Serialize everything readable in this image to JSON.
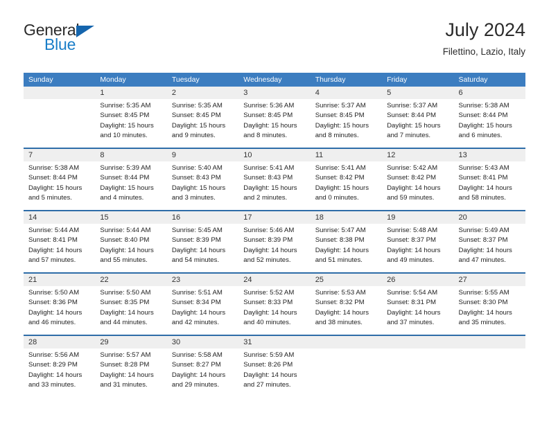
{
  "brand": {
    "name_top": "General",
    "name_bottom": "Blue",
    "accent_color": "#1a7ec8",
    "triangle_color": "#1565ad"
  },
  "header": {
    "title": "July 2024",
    "subtitle": "Filettino, Lazio, Italy"
  },
  "theme": {
    "header_row_bg": "#3c7dc0",
    "week_divider": "#2e6da8",
    "daynum_band_bg": "#efefef",
    "text_color": "#222222"
  },
  "calendar": {
    "weekdays": [
      "Sunday",
      "Monday",
      "Tuesday",
      "Wednesday",
      "Thursday",
      "Friday",
      "Saturday"
    ],
    "weeks": [
      [
        {
          "day": "",
          "detail": ""
        },
        {
          "day": "1",
          "detail": "Sunrise: 5:35 AM\nSunset: 8:45 PM\nDaylight: 15 hours\nand 10 minutes."
        },
        {
          "day": "2",
          "detail": "Sunrise: 5:35 AM\nSunset: 8:45 PM\nDaylight: 15 hours\nand 9 minutes."
        },
        {
          "day": "3",
          "detail": "Sunrise: 5:36 AM\nSunset: 8:45 PM\nDaylight: 15 hours\nand 8 minutes."
        },
        {
          "day": "4",
          "detail": "Sunrise: 5:37 AM\nSunset: 8:45 PM\nDaylight: 15 hours\nand 8 minutes."
        },
        {
          "day": "5",
          "detail": "Sunrise: 5:37 AM\nSunset: 8:44 PM\nDaylight: 15 hours\nand 7 minutes."
        },
        {
          "day": "6",
          "detail": "Sunrise: 5:38 AM\nSunset: 8:44 PM\nDaylight: 15 hours\nand 6 minutes."
        }
      ],
      [
        {
          "day": "7",
          "detail": "Sunrise: 5:38 AM\nSunset: 8:44 PM\nDaylight: 15 hours\nand 5 minutes."
        },
        {
          "day": "8",
          "detail": "Sunrise: 5:39 AM\nSunset: 8:44 PM\nDaylight: 15 hours\nand 4 minutes."
        },
        {
          "day": "9",
          "detail": "Sunrise: 5:40 AM\nSunset: 8:43 PM\nDaylight: 15 hours\nand 3 minutes."
        },
        {
          "day": "10",
          "detail": "Sunrise: 5:41 AM\nSunset: 8:43 PM\nDaylight: 15 hours\nand 2 minutes."
        },
        {
          "day": "11",
          "detail": "Sunrise: 5:41 AM\nSunset: 8:42 PM\nDaylight: 15 hours\nand 0 minutes."
        },
        {
          "day": "12",
          "detail": "Sunrise: 5:42 AM\nSunset: 8:42 PM\nDaylight: 14 hours\nand 59 minutes."
        },
        {
          "day": "13",
          "detail": "Sunrise: 5:43 AM\nSunset: 8:41 PM\nDaylight: 14 hours\nand 58 minutes."
        }
      ],
      [
        {
          "day": "14",
          "detail": "Sunrise: 5:44 AM\nSunset: 8:41 PM\nDaylight: 14 hours\nand 57 minutes."
        },
        {
          "day": "15",
          "detail": "Sunrise: 5:44 AM\nSunset: 8:40 PM\nDaylight: 14 hours\nand 55 minutes."
        },
        {
          "day": "16",
          "detail": "Sunrise: 5:45 AM\nSunset: 8:39 PM\nDaylight: 14 hours\nand 54 minutes."
        },
        {
          "day": "17",
          "detail": "Sunrise: 5:46 AM\nSunset: 8:39 PM\nDaylight: 14 hours\nand 52 minutes."
        },
        {
          "day": "18",
          "detail": "Sunrise: 5:47 AM\nSunset: 8:38 PM\nDaylight: 14 hours\nand 51 minutes."
        },
        {
          "day": "19",
          "detail": "Sunrise: 5:48 AM\nSunset: 8:37 PM\nDaylight: 14 hours\nand 49 minutes."
        },
        {
          "day": "20",
          "detail": "Sunrise: 5:49 AM\nSunset: 8:37 PM\nDaylight: 14 hours\nand 47 minutes."
        }
      ],
      [
        {
          "day": "21",
          "detail": "Sunrise: 5:50 AM\nSunset: 8:36 PM\nDaylight: 14 hours\nand 46 minutes."
        },
        {
          "day": "22",
          "detail": "Sunrise: 5:50 AM\nSunset: 8:35 PM\nDaylight: 14 hours\nand 44 minutes."
        },
        {
          "day": "23",
          "detail": "Sunrise: 5:51 AM\nSunset: 8:34 PM\nDaylight: 14 hours\nand 42 minutes."
        },
        {
          "day": "24",
          "detail": "Sunrise: 5:52 AM\nSunset: 8:33 PM\nDaylight: 14 hours\nand 40 minutes."
        },
        {
          "day": "25",
          "detail": "Sunrise: 5:53 AM\nSunset: 8:32 PM\nDaylight: 14 hours\nand 38 minutes."
        },
        {
          "day": "26",
          "detail": "Sunrise: 5:54 AM\nSunset: 8:31 PM\nDaylight: 14 hours\nand 37 minutes."
        },
        {
          "day": "27",
          "detail": "Sunrise: 5:55 AM\nSunset: 8:30 PM\nDaylight: 14 hours\nand 35 minutes."
        }
      ],
      [
        {
          "day": "28",
          "detail": "Sunrise: 5:56 AM\nSunset: 8:29 PM\nDaylight: 14 hours\nand 33 minutes."
        },
        {
          "day": "29",
          "detail": "Sunrise: 5:57 AM\nSunset: 8:28 PM\nDaylight: 14 hours\nand 31 minutes."
        },
        {
          "day": "30",
          "detail": "Sunrise: 5:58 AM\nSunset: 8:27 PM\nDaylight: 14 hours\nand 29 minutes."
        },
        {
          "day": "31",
          "detail": "Sunrise: 5:59 AM\nSunset: 8:26 PM\nDaylight: 14 hours\nand 27 minutes."
        },
        {
          "day": "",
          "detail": ""
        },
        {
          "day": "",
          "detail": ""
        },
        {
          "day": "",
          "detail": ""
        }
      ]
    ]
  }
}
